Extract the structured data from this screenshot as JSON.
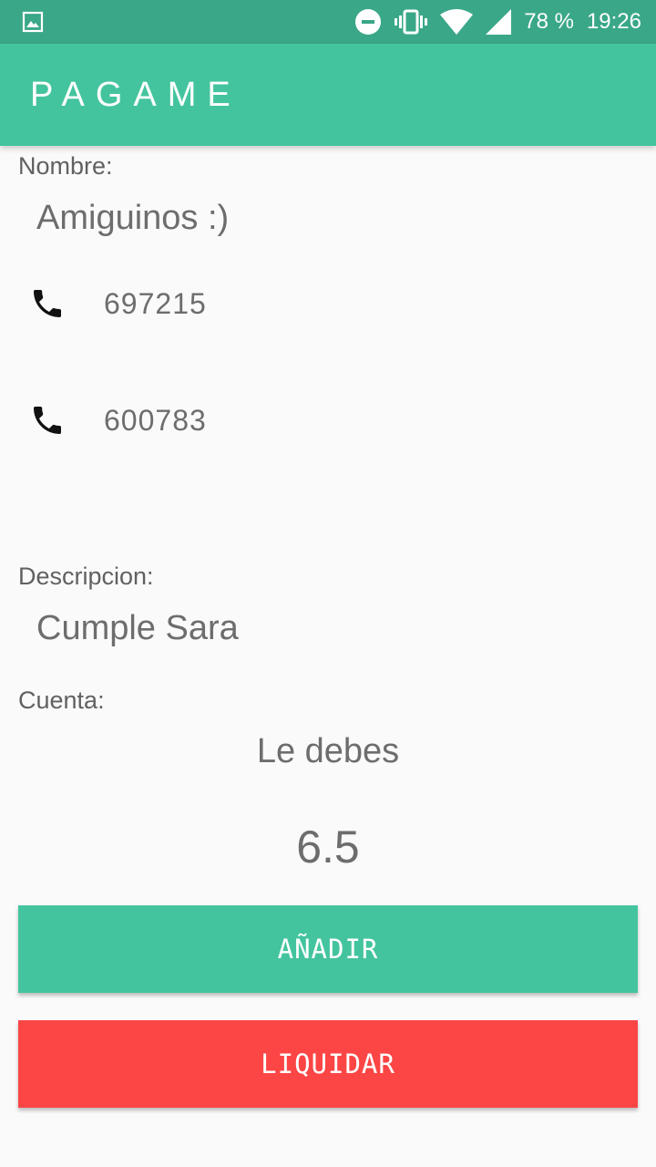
{
  "status_bar": {
    "battery": "78 %",
    "time": "19:26",
    "icons": [
      "image-notification-icon",
      "do-not-disturb-icon",
      "vibrate-icon",
      "wifi-icon",
      "signal-icon"
    ]
  },
  "app_bar": {
    "title": "PAGAME"
  },
  "form": {
    "nombre_label": "Nombre:",
    "nombre_value": "Amiguinos :)",
    "phones": [
      "697215",
      "600783"
    ],
    "descripcion_label": "Descripcion:",
    "descripcion_value": "Cumple Sara",
    "cuenta_label": "Cuenta:",
    "cuenta_status": "Le debes",
    "cuenta_amount": "6.5"
  },
  "buttons": {
    "add_label": "AÑADIR",
    "liquidar_label": "LIQUIDAR"
  },
  "colors": {
    "status_bar": "#3aa788",
    "accent": "#44c49e",
    "danger": "#fc4545",
    "background": "#fafafa"
  }
}
